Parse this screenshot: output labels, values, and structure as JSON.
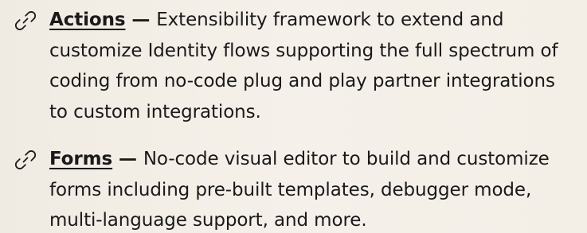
{
  "features": [
    {
      "icon": "link-icon",
      "title": "Actions",
      "separator": " — ",
      "description": "Extensibility framework to extend and customize Identity flows supporting the full spectrum of coding from no-code plug and play partner integrations to custom integrations."
    },
    {
      "icon": "link-icon",
      "title": "Forms",
      "separator": " — ",
      "description": "No-code visual editor to build and customize forms including pre-built templates, debugger mode, multi-language support, and more."
    }
  ]
}
